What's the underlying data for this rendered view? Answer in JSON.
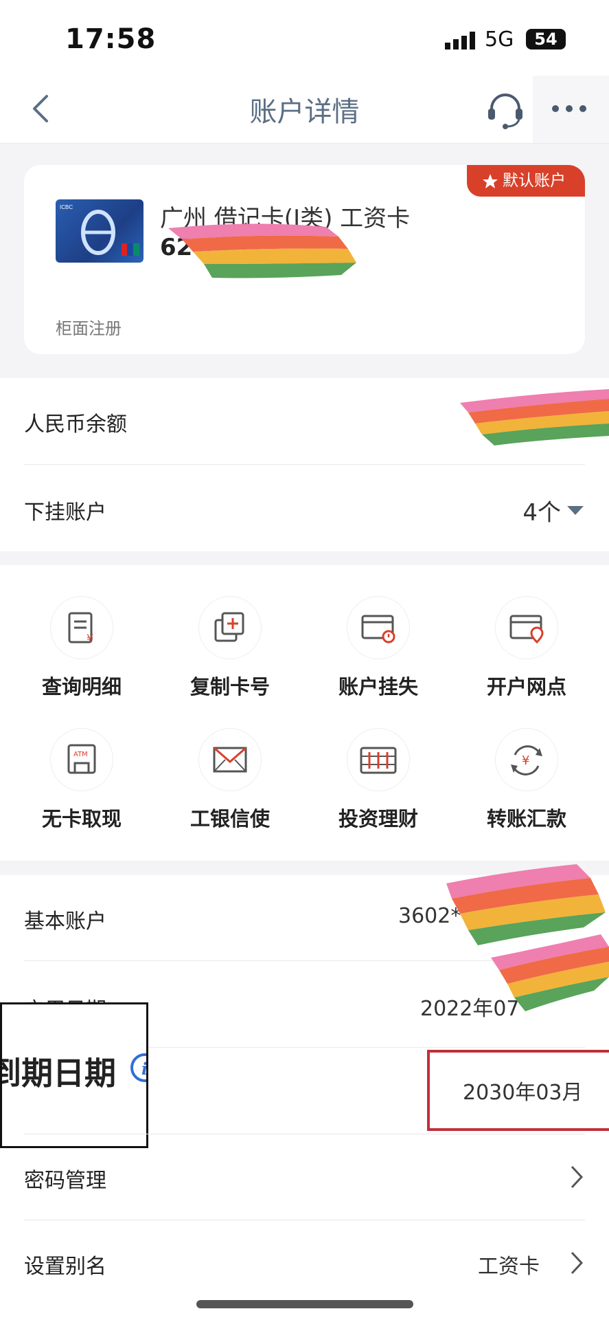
{
  "status": {
    "time": "17:58",
    "network": "5G",
    "battery": "54"
  },
  "nav": {
    "title": "账户详情"
  },
  "card": {
    "badge": "默认账户",
    "name": "广州 借记卡(Ⅰ类) 工资卡",
    "number_prefix": "62",
    "registration": "柜面注册"
  },
  "balance": {
    "label": "人民币余额"
  },
  "sub_accounts": {
    "label": "下挂账户",
    "count": "4个"
  },
  "actions": [
    {
      "label": "查询明细"
    },
    {
      "label": "复制卡号"
    },
    {
      "label": "账户挂失"
    },
    {
      "label": "开户网点"
    },
    {
      "label": "无卡取现"
    },
    {
      "label": "工银信使"
    },
    {
      "label": "投资理财"
    },
    {
      "label": "转账汇款"
    }
  ],
  "details": {
    "basic_account": {
      "label": "基本账户",
      "value": "3602*"
    },
    "start_date": {
      "label": "启用日期",
      "value": "2022年07"
    },
    "expiry_date": {
      "label": "到期日期",
      "value": "2030年03月"
    },
    "password": {
      "label": "密码管理"
    },
    "alias": {
      "label": "设置别名",
      "value": "工资卡"
    }
  },
  "colors": {
    "accent": "#d8402a",
    "nav_text": "#5b6f85",
    "annotation_red": "#c0303a"
  }
}
